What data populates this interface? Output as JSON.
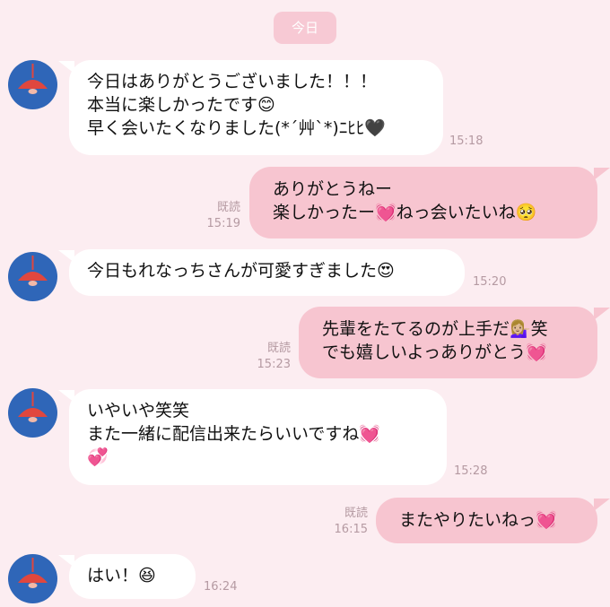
{
  "date_label": "今日",
  "colors": {
    "background": "#fcedf1",
    "incoming_bubble": "#ffffff",
    "outgoing_bubble": "#f7c5d0",
    "avatar": "#2f66b8",
    "lamp": "#e0473e"
  },
  "messages": [
    {
      "dir": "in",
      "text": "今日はありがとうございました！！！\n本当に楽しかったです😊\n早く会いたくなりました(*´艸`*)ﾆﾋﾋ🖤",
      "time": "15:18"
    },
    {
      "dir": "out",
      "text": "ありがとうねー\n楽しかったー💓ねっ会いたいね🥺",
      "read": "既読",
      "time": "15:19"
    },
    {
      "dir": "in",
      "text": "今日もれなっちさんが可愛すぎました😍",
      "time": "15:20"
    },
    {
      "dir": "out",
      "text": "先輩をたてるのが上手だ💁🏼‍♀️笑\nでも嬉しいよっありがとう💓",
      "read": "既読",
      "time": "15:23"
    },
    {
      "dir": "in",
      "text": "いやいや笑笑\nまた一緒に配信出来たらいいですね💓\n💞",
      "time": "15:28"
    },
    {
      "dir": "out",
      "text": "またやりたいねっ💓",
      "read": "既読",
      "time": "16:15"
    },
    {
      "dir": "in",
      "text": "はい！😆",
      "time": "16:24"
    }
  ]
}
